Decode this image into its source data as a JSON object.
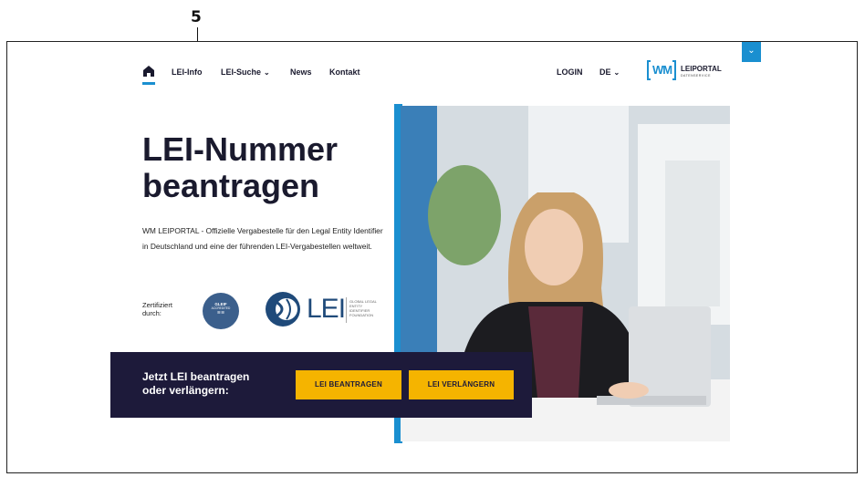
{
  "annotation": {
    "number": "5"
  },
  "nav": {
    "items": [
      {
        "label": "LEI-Info"
      },
      {
        "label": "LEI-Suche",
        "chevron": "⌄"
      },
      {
        "label": "News"
      },
      {
        "label": "Kontakt"
      }
    ],
    "login": "LOGIN",
    "language": "DE",
    "language_chevron": "⌄"
  },
  "logo": {
    "mark": "WM",
    "title": "LEIPORTAL",
    "subtitle": "DATENSERVICE"
  },
  "corner_button": {
    "glyph": "⌄"
  },
  "hero": {
    "title": "LEI-Nummer beantragen",
    "description": "WM LEIPORTAL - Offizielle Vergabestelle für den Legal Entity Identifier in Deutschland und eine der führenden LEI-Vergabestellen weltweit.",
    "certified_label": "Zertifiziert durch:",
    "gleif_badge": {
      "title": "GLEIF",
      "subtitle": "ACCREDITED"
    },
    "lei_logo": {
      "text": "LEI",
      "small": "GLOBAL LEGAL ENTITY IDENTIFIER FOUNDATION"
    }
  },
  "cta": {
    "text": "Jetzt LEI beantragen oder verlängern:",
    "apply_button": "LEI BEANTRAGEN",
    "renew_button": "LEI VERLÄNGERN"
  },
  "colors": {
    "accent": "#1a8fd0",
    "navy": "#1d1a3a",
    "button": "#f5b400"
  },
  "icons": {
    "home": "home-icon",
    "chevron": "chevron-down-icon"
  }
}
